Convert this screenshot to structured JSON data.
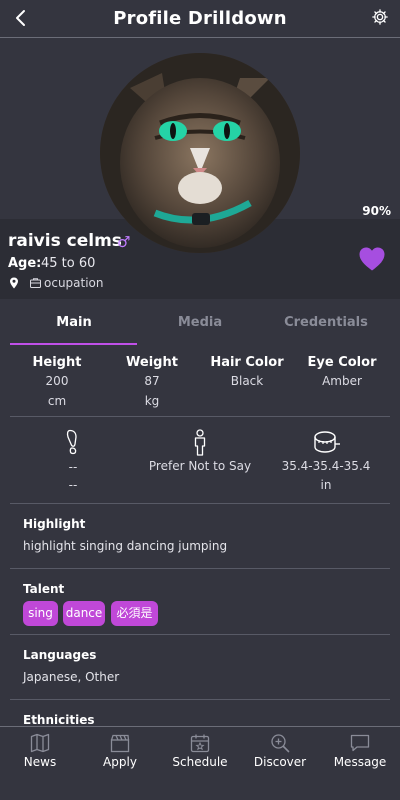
{
  "header": {
    "title": "Profile Drilldown"
  },
  "profile": {
    "completion": "90%",
    "name": "raivis celms",
    "gender_symbol": "♂",
    "age_label": "Age:",
    "age_value": "45 to 60",
    "occupation": "ocupation"
  },
  "tabs": [
    "Main",
    "Media",
    "Credentials"
  ],
  "stats": [
    {
      "label": "Height",
      "value": "200",
      "unit": "cm"
    },
    {
      "label": "Weight",
      "value": "87",
      "unit": "kg"
    },
    {
      "label": "Hair Color",
      "value": "Black",
      "unit": ""
    },
    {
      "label": "Eye Color",
      "value": "Amber",
      "unit": ""
    }
  ],
  "measurements": {
    "shoe": {
      "line1": "--",
      "line2": "--"
    },
    "gender": "Prefer Not to Say",
    "tape": {
      "line1": "35.4-35.4-35.4",
      "line2": "in"
    }
  },
  "sections": {
    "highlight": {
      "title": "Highlight",
      "body": "highlight singing dancing jumping"
    },
    "talent": {
      "title": "Talent",
      "chips": [
        "sing",
        "dance",
        "必須是"
      ]
    },
    "languages": {
      "title": "Languages",
      "body": "Japanese, Other"
    },
    "ethnicities": {
      "title": "Ethnicities"
    }
  },
  "bottom_nav": [
    {
      "label": "News",
      "icon": "map-icon"
    },
    {
      "label": "Apply",
      "icon": "clapperboard-icon"
    },
    {
      "label": "Schedule",
      "icon": "calendar-icon"
    },
    {
      "label": "Discover",
      "icon": "search-zoom-icon"
    },
    {
      "label": "Message",
      "icon": "chat-icon"
    }
  ],
  "colors": {
    "accent": "#c048d8",
    "background": "#34353f",
    "heart": "#a64ee0"
  }
}
